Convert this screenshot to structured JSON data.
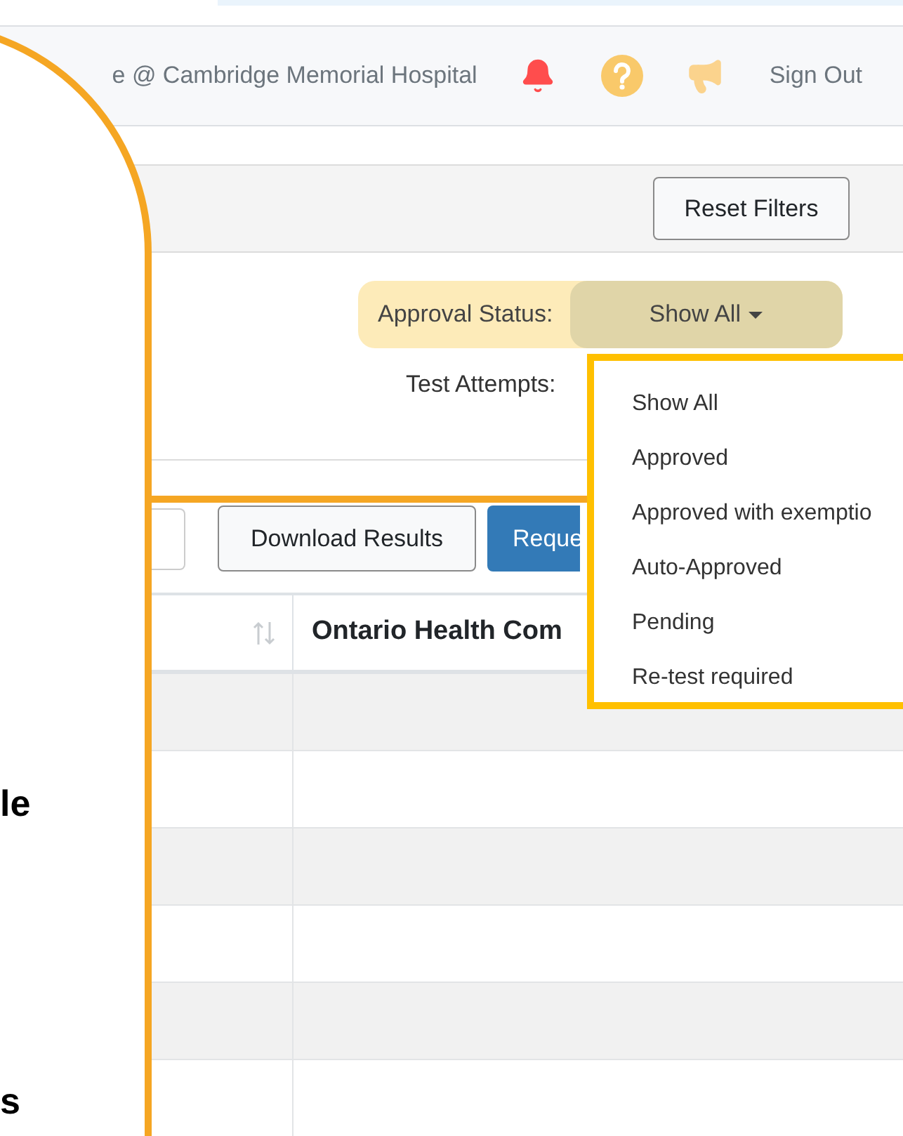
{
  "header": {
    "user_text": "e @ Cambridge Memorial Hospital",
    "sign_out": "Sign Out"
  },
  "filters": {
    "reset_button": "Reset Filters",
    "approval_status": {
      "label": "Approval Status:",
      "value": "Show All",
      "expanded": true
    },
    "test_attempts": {
      "label": "Test Attempts:"
    }
  },
  "toolbar": {
    "download_button": "Download Results",
    "request_button": "Reque"
  },
  "table": {
    "column_2": "Ontario Health Com"
  },
  "approval_menu": {
    "options": [
      {
        "label": "Show All"
      },
      {
        "label": "Approved"
      },
      {
        "label": "Approved with exemptio"
      },
      {
        "label": "Auto-Approved"
      },
      {
        "label": "Pending"
      },
      {
        "label": "Re-test required"
      }
    ]
  },
  "callout": {
    "text_fragments": [
      "le",
      "s"
    ]
  }
}
